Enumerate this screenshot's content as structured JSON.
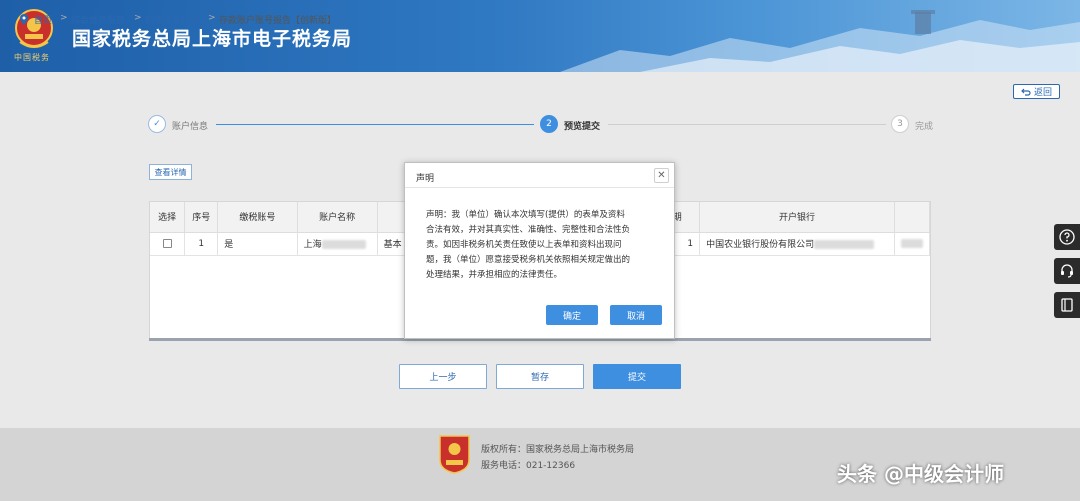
{
  "header": {
    "emblem_text": "中国税务",
    "title": "国家税务总局上海市电子税务局"
  },
  "breadcrumb": {
    "home": "首页",
    "items": [
      "综合信息报告",
      "制度信息报告",
      "存款账户账号报告【创新版】"
    ],
    "separator": ">",
    "back_label": "返回"
  },
  "stepper": {
    "steps": [
      {
        "number": "✓",
        "label": "账户信息",
        "state": "done"
      },
      {
        "number": "2",
        "label": "预览提交",
        "state": "active"
      },
      {
        "number": "3",
        "label": "完成",
        "state": "pending"
      }
    ]
  },
  "toolbar": {
    "detail_button": "查看详情"
  },
  "table": {
    "columns": [
      "选择",
      "序号",
      "缴税账号",
      "账户名称",
      "",
      "",
      "",
      "期",
      "开户银行"
    ],
    "rows": [
      {
        "seq": "1",
        "tax_account": "是",
        "name": "上海",
        "type": "基本",
        "date": "1",
        "bank": "中国农业银行股份有限公司"
      }
    ]
  },
  "nav": {
    "prev": "上一步",
    "save": "暂存",
    "submit": "提交"
  },
  "dialog": {
    "title": "声明",
    "lines": [
      "声明：我（单位）确认本次填写(提供）的表单及资料",
      "合法有效，并对其真实性、准确性、完整性和合法性负",
      "责。如因非税务机关责任致使以上表单和资料出现问",
      "题，我（单位）愿意接受税务机关依照相关规定做出的",
      "处理结果，并承担相应的法律责任。"
    ],
    "confirm": "确定",
    "cancel": "取消"
  },
  "side_tools": [
    "help-icon",
    "headset-icon",
    "book-icon"
  ],
  "footer": {
    "copyright": "版权所有：国家税务总局上海市税务局",
    "phone": "服务电话：021-12366"
  },
  "watermark": "头条 @中级会计师",
  "colors": {
    "primary": "#3f8fe0",
    "link": "#2a68b1",
    "header_dark": "#1e5fa8"
  }
}
